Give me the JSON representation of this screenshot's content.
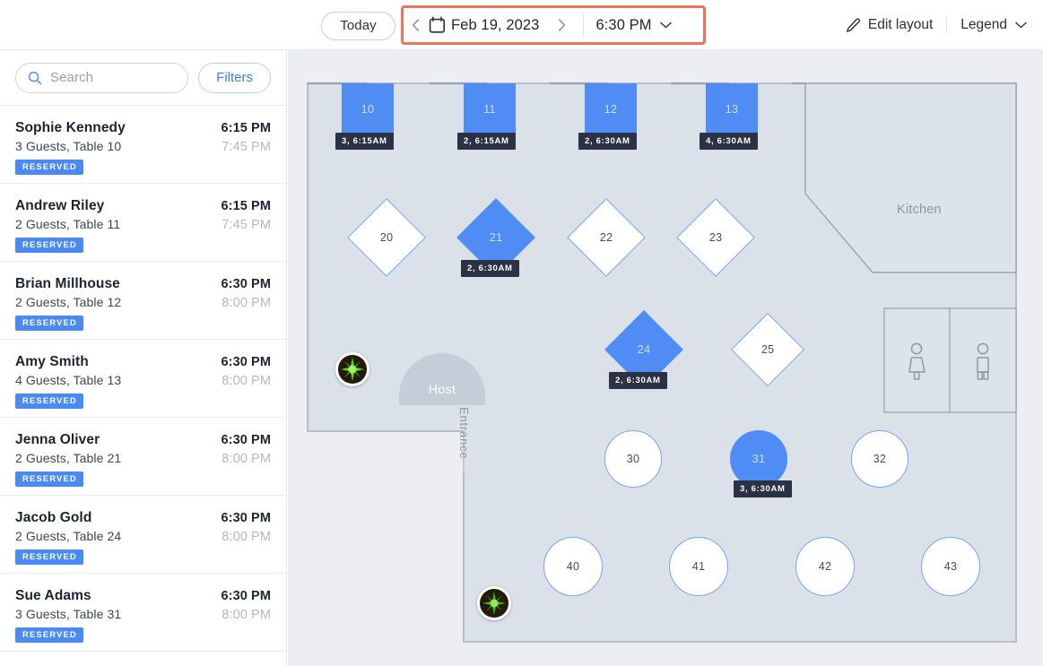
{
  "topbar": {
    "today_label": "Today",
    "date_label": "Feb 19, 2023",
    "time_label": "6:30 PM",
    "prev_label": "‹",
    "next_label": "›",
    "edit_layout_label": "Edit layout",
    "legend_label": "Legend",
    "highlight_color": "#f2715a"
  },
  "sidebar": {
    "search": {
      "placeholder": "Search",
      "value": ""
    },
    "filters_label": "Filters",
    "reservations": [
      {
        "name": "Sophie Kennedy",
        "details": "3 Guests, Table 10",
        "status": "RESERVED",
        "start": "6:15 PM",
        "end": "7:45 PM"
      },
      {
        "name": "Andrew Riley",
        "details": "2 Guests, Table 11",
        "status": "RESERVED",
        "start": "6:15 PM",
        "end": "7:45 PM"
      },
      {
        "name": "Brian Millhouse",
        "details": "2 Guests, Table 12",
        "status": "RESERVED",
        "start": "6:30 PM",
        "end": "8:00 PM"
      },
      {
        "name": "Amy Smith",
        "details": "4 Guests, Table 13",
        "status": "RESERVED",
        "start": "6:30 PM",
        "end": "8:00 PM"
      },
      {
        "name": "Jenna Oliver",
        "details": "2 Guests, Table 21",
        "status": "RESERVED",
        "start": "6:30 PM",
        "end": "8:00 PM"
      },
      {
        "name": "Jacob Gold",
        "details": "2 Guests, Table 24",
        "status": "RESERVED",
        "start": "6:30 PM",
        "end": "8:00 PM"
      },
      {
        "name": "Sue Adams",
        "details": "3 Guests, Table 31",
        "status": "RESERVED",
        "start": "6:30 PM",
        "end": "8:00 PM"
      }
    ]
  },
  "floorplan": {
    "kitchen_label": "Kitchen",
    "host_label": "Host",
    "entrance_label": "Entrance",
    "occupied_color": "#4f8df5",
    "free_color": "#ffffff",
    "outline_color": "#7ba4f0",
    "badge_color": "#2b3245",
    "tables": [
      {
        "id": "10",
        "shape": "square",
        "status": "occupied",
        "badge": "3,  6:15AM"
      },
      {
        "id": "11",
        "shape": "square",
        "status": "occupied",
        "badge": "2,  6:15AM"
      },
      {
        "id": "12",
        "shape": "square",
        "status": "occupied",
        "badge": "2,  6:30AM"
      },
      {
        "id": "13",
        "shape": "square",
        "status": "occupied",
        "badge": "4, 6:30AM"
      },
      {
        "id": "20",
        "shape": "diamond",
        "status": "free",
        "badge": ""
      },
      {
        "id": "21",
        "shape": "diamond",
        "status": "occupied",
        "badge": "2,  6:30AM"
      },
      {
        "id": "22",
        "shape": "diamond",
        "status": "free",
        "badge": ""
      },
      {
        "id": "23",
        "shape": "diamond",
        "status": "free",
        "badge": ""
      },
      {
        "id": "24",
        "shape": "diamond",
        "status": "occupied",
        "badge": "2,  6:30AM"
      },
      {
        "id": "25",
        "shape": "diamond",
        "status": "free",
        "badge": ""
      },
      {
        "id": "30",
        "shape": "circle",
        "status": "free",
        "badge": ""
      },
      {
        "id": "31",
        "shape": "circle",
        "status": "occupied",
        "badge": "3,  6:30AM"
      },
      {
        "id": "32",
        "shape": "circle",
        "status": "free",
        "badge": ""
      },
      {
        "id": "40",
        "shape": "circle",
        "status": "free",
        "badge": ""
      },
      {
        "id": "41",
        "shape": "circle",
        "status": "free",
        "badge": ""
      },
      {
        "id": "42",
        "shape": "circle",
        "status": "free",
        "badge": ""
      },
      {
        "id": "43",
        "shape": "circle",
        "status": "free",
        "badge": ""
      }
    ]
  }
}
